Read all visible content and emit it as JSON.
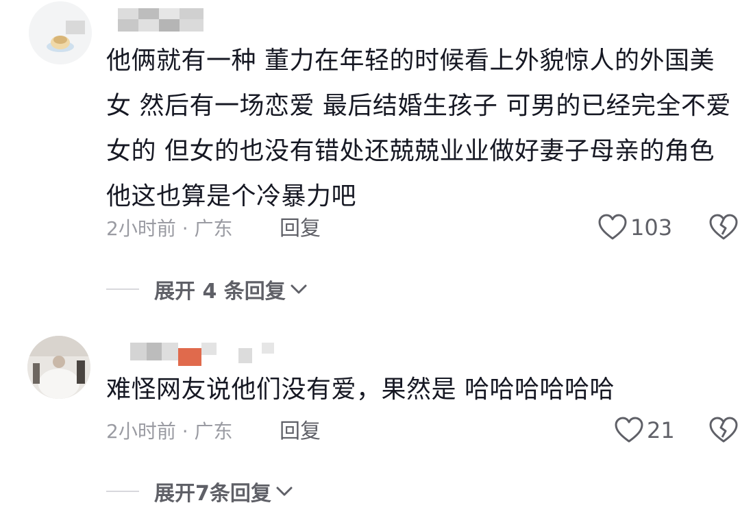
{
  "comments": [
    {
      "text": "他俩就有一种  董力在年轻的时候看上外貌惊人的外国美女  然后有一场恋爱 最后结婚生孩子  可男的已经完全不爱女的  但女的也没有错处还兢兢业业做好妻子母亲的角色  他这也算是个冷暴力吧",
      "time": "2小时前 · 广东",
      "reply_label": "回复",
      "likes": "103",
      "expand_label": "展开 4 条回复"
    },
    {
      "text": "难怪网友说他们没有爱，果然是 哈哈哈哈哈哈",
      "time": "2小时前 · 广东",
      "reply_label": "回复",
      "likes": "21",
      "expand_label": "展开7条回复"
    }
  ],
  "icons": {
    "like": "heart-outline-icon",
    "dislike": "broken-heart-icon",
    "expand": "chevron-down-icon"
  },
  "colors": {
    "text": "#161823",
    "meta": "#9a9ba2",
    "action": "#5f6067"
  }
}
